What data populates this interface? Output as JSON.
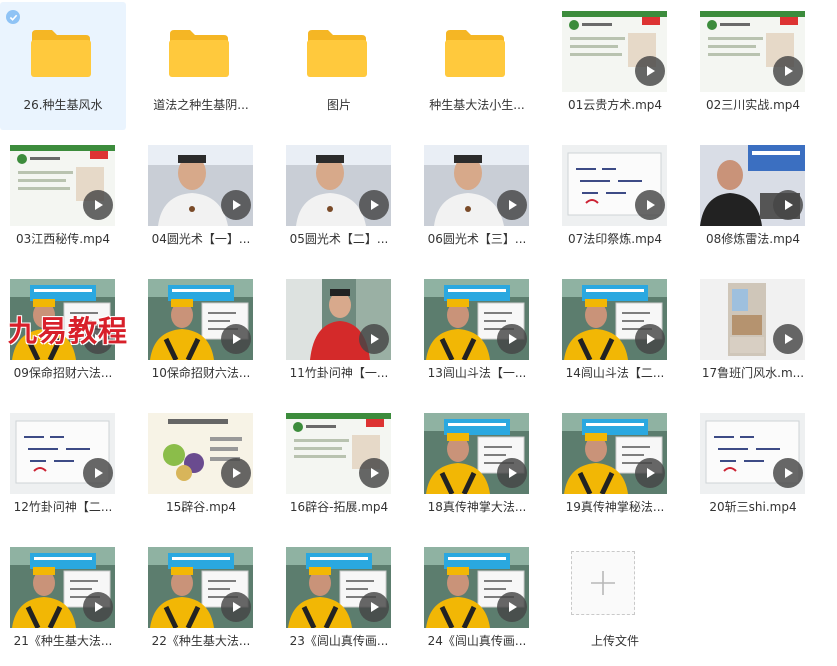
{
  "items": [
    {
      "label": "26.种生基风水",
      "type": "folder",
      "selected": true
    },
    {
      "label": "道法之种生基阴...",
      "type": "folder"
    },
    {
      "label": "图片",
      "type": "folder"
    },
    {
      "label": "种生基大法小生...",
      "type": "folder"
    },
    {
      "label": "01云贵方术.mp4",
      "type": "video",
      "scene": "slide-green"
    },
    {
      "label": "02三川实战.mp4",
      "type": "video",
      "scene": "slide-green"
    },
    {
      "label": "03江西秘传.mp4",
      "type": "video",
      "scene": "slide-green"
    },
    {
      "label": "04圆光术【一】...",
      "type": "video",
      "scene": "man-white"
    },
    {
      "label": "05圆光术【二】...",
      "type": "video",
      "scene": "man-white"
    },
    {
      "label": "06圆光术【三】...",
      "type": "video",
      "scene": "man-white"
    },
    {
      "label": "07法印祭炼.mp4",
      "type": "video",
      "scene": "whiteboard"
    },
    {
      "label": "08修炼雷法.mp4",
      "type": "video",
      "scene": "man-dark"
    },
    {
      "label": "09保命招财六法...",
      "type": "video",
      "scene": "yellow-robe"
    },
    {
      "label": "10保命招财六法...",
      "type": "video",
      "scene": "yellow-robe"
    },
    {
      "label": "11竹卦问神【一...",
      "type": "video",
      "scene": "red-shirt"
    },
    {
      "label": "13闾山斗法【一...",
      "type": "video",
      "scene": "yellow-robe"
    },
    {
      "label": "14闾山斗法【二...",
      "type": "video",
      "scene": "yellow-robe"
    },
    {
      "label": "17鲁班门风水.m...",
      "type": "video",
      "scene": "room"
    },
    {
      "label": "12竹卦问神【二...",
      "type": "video",
      "scene": "whiteboard"
    },
    {
      "label": "15辟谷.mp4",
      "type": "video",
      "scene": "slide-food"
    },
    {
      "label": "16辟谷-拓展.mp4",
      "type": "video",
      "scene": "slide-green"
    },
    {
      "label": "18真传神掌大法...",
      "type": "video",
      "scene": "yellow-robe"
    },
    {
      "label": "19真传神掌秘法...",
      "type": "video",
      "scene": "yellow-robe"
    },
    {
      "label": "20斩三shi.mp4",
      "type": "video",
      "scene": "whiteboard"
    },
    {
      "label": "21《种生基大法...",
      "type": "video",
      "scene": "yellow-robe"
    },
    {
      "label": "22《种生基大法...",
      "type": "video",
      "scene": "yellow-robe"
    },
    {
      "label": "23《闾山真传画...",
      "type": "video",
      "scene": "yellow-robe"
    },
    {
      "label": "24《闾山真传画...",
      "type": "video",
      "scene": "yellow-robe"
    },
    {
      "label": "上传文件",
      "type": "upload"
    }
  ],
  "watermark": "九易教程",
  "colors": {
    "folder": "#ffc93d",
    "folder_tab": "#f5b624",
    "selected_bg": "#eaf4fe",
    "check": "#8fc3f5",
    "play": "#464646",
    "robe": "#f2b705",
    "banner": "#2aa8e0"
  }
}
